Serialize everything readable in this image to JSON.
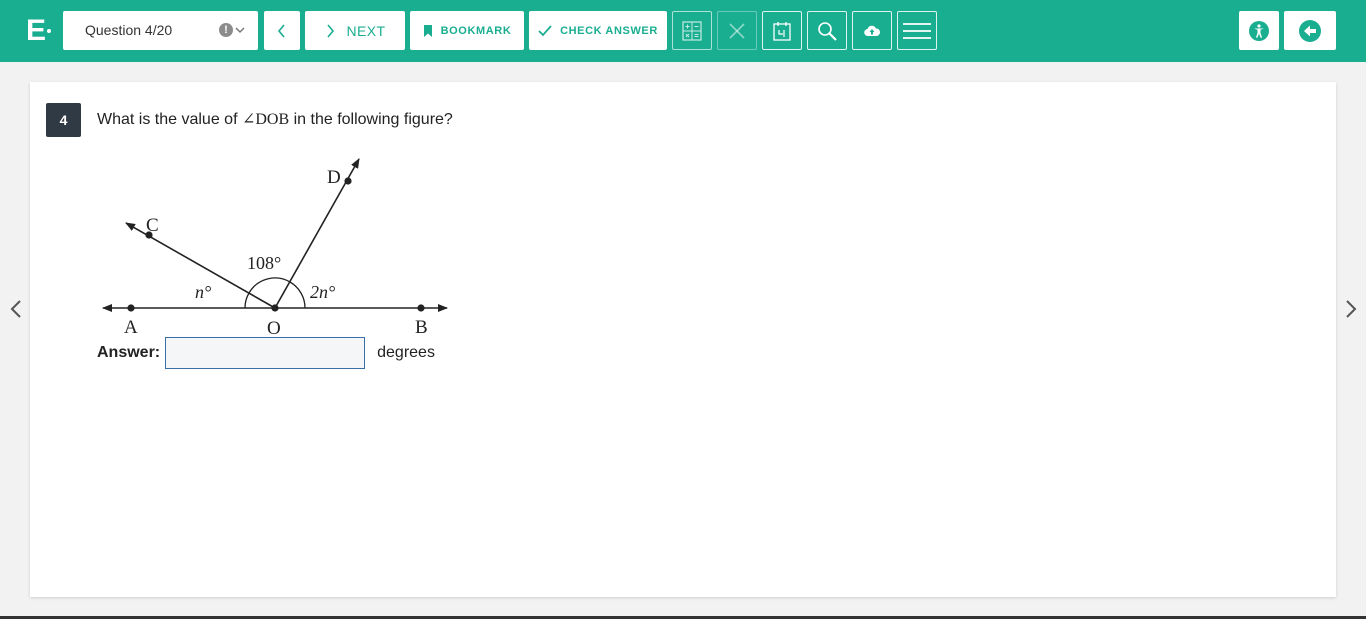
{
  "toolbar": {
    "logo_letter": "E",
    "question_selector": "Question 4/20",
    "next_label": "NEXT",
    "bookmark_label": "BOOKMARK",
    "check_answer_label": "CHECK ANSWER",
    "icons": [
      "chevron-left-icon",
      "chevron-right-icon",
      "bookmark-icon",
      "check-icon",
      "calculator-icon",
      "close-icon",
      "calendar-icon",
      "search-icon",
      "cloud-upload-icon",
      "menu-icon",
      "accessibility-icon",
      "exit-icon"
    ]
  },
  "question": {
    "number": "4",
    "text_before": "What is the value of ",
    "math": "∠DOB",
    "text_after": " in the following figure?"
  },
  "figure": {
    "points": {
      "a": "A",
      "b": "B",
      "c": "C",
      "d": "D",
      "o": "O"
    },
    "angles": {
      "aoc": "n°",
      "cod": "108°",
      "dob": "2n°"
    }
  },
  "answer": {
    "label": "Answer:",
    "value": "",
    "placeholder": "",
    "unit": "degrees"
  },
  "colors": {
    "accent": "#1aae91",
    "question_badge": "#2f3a44"
  }
}
